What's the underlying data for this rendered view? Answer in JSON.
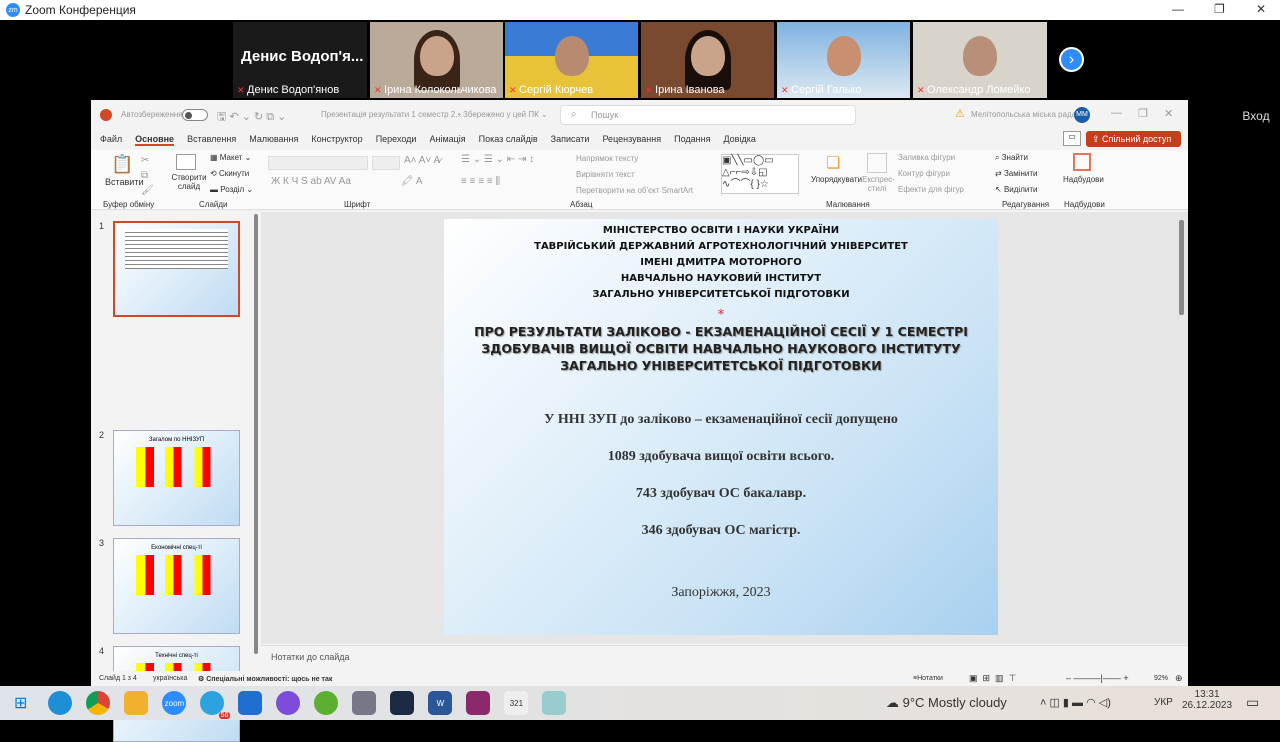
{
  "zoom": {
    "logo": "zm",
    "title": "Zoom Конференция",
    "sign_in": "Вход"
  },
  "participants": [
    {
      "name": "Денис Водоп'я...",
      "label": "Денис Водоп'янов"
    },
    {
      "name": "Ірина Колокольчикова"
    },
    {
      "name": "Сергій Кюрчев"
    },
    {
      "name": "Ірина Іванова"
    },
    {
      "name": "Сергій Галько"
    },
    {
      "name": "Олександр Ломейко"
    }
  ],
  "ppt": {
    "autosave": "Автозбереження",
    "doc_title": "Презентація результати 1 семестр 2...",
    "saved": "• Збережено у цей ПК ⌄",
    "search": "Пошук",
    "org": "Мелітопольська міська рада",
    "avatar": "ММ",
    "tabs": [
      "Файл",
      "Основне",
      "Вставлення",
      "Малювання",
      "Конструктор",
      "Переходи",
      "Анімація",
      "Показ слайдів",
      "Записати",
      "Рецензування",
      "Подання",
      "Довідка"
    ],
    "share": "Спільний доступ",
    "ribbon": {
      "paste": "Вставити",
      "clipboard": "Буфер обміну",
      "new_slide": "Створити слайд",
      "layout": "Макет",
      "reset": "Скинути",
      "section": "Розділ",
      "slides": "Слайди",
      "font": "Шрифт",
      "font_btns": "Ж  К  Ч  S  ab  AV  Aa",
      "text_dir": "Напрямок тексту",
      "align_text": "Вирівняти текст",
      "smartart": "Перетворити на об'єкт SmartArt",
      "paragraph": "Абзац",
      "arrange": "Упорядкувати",
      "quick_styles": "Експрес-стилі",
      "fill": "Заливка фігури",
      "outline": "Контур фігури",
      "effects": "Ефекти для фігур",
      "drawing": "Малювання",
      "find": "Знайти",
      "replace": "Замінити",
      "select": "Виділити",
      "editing": "Редагування",
      "addins": "Надбудови",
      "addins_group": "Надбудови"
    },
    "slide": {
      "header": [
        "МІНІСТЕРСТВО ОСВІТИ І НАУКИ УКРАЇНИ",
        "ТАВРІЙСЬКИЙ ДЕРЖАВНИЙ АГРОТЕХНОЛОГІЧНИЙ УНІВЕРСИТЕТ",
        "ІМЕНІ ДМИТРА МОТОРНОГО",
        "НАВЧАЛЬНО НАУКОВИЙ ІНСТИТУТ",
        "ЗАГАЛЬНО УНІВЕРСИТЕТСЬКОЇ ПІДГОТОВКИ"
      ],
      "star": "*",
      "title": [
        "ПРО РЕЗУЛЬТАТИ ЗАЛІКОВО - ЕКЗАМЕНАЦІЙНОЇ СЕСІЇ У 1 СЕМЕСТРІ",
        "ЗДОБУВАЧІВ ВИЩОЇ ОСВІТИ НАВЧАЛЬНО НАУКОВОГО ІНСТИТУТУ",
        "ЗАГАЛЬНО УНІВЕРСИТЕТСЬКОЇ ПІДГОТОВКИ"
      ],
      "lines": [
        "У ННІ ЗУП до заліково – екзаменаційної сесії допущено",
        "1089 здобувача вищої освіти всього.",
        "743 здобувач ОС бакалавр.",
        "346 здобувач ОС магістр."
      ],
      "footer": "Запоріжжя, 2023"
    },
    "thumbs": [
      {
        "n": "1"
      },
      {
        "n": "2",
        "title": "Загалом по ННІЗУП"
      },
      {
        "n": "3",
        "title": "Економічні спец-ті"
      },
      {
        "n": "4",
        "title": "Технічні спец-ті"
      }
    ],
    "notes": "Нотатки до слайда",
    "status": {
      "slide": "Слайд 1 з 4",
      "lang": "українська",
      "access": "Спеціальні можливості: щось не так",
      "notes": "Нотатки",
      "zoom": "92%"
    }
  },
  "taskbar": {
    "weather": "9°C  Mostly cloudy",
    "lang": "УКР",
    "time": "13:31",
    "date": "26.12.2023",
    "telegram_badge": "56",
    "zoom_app": "zoom"
  }
}
